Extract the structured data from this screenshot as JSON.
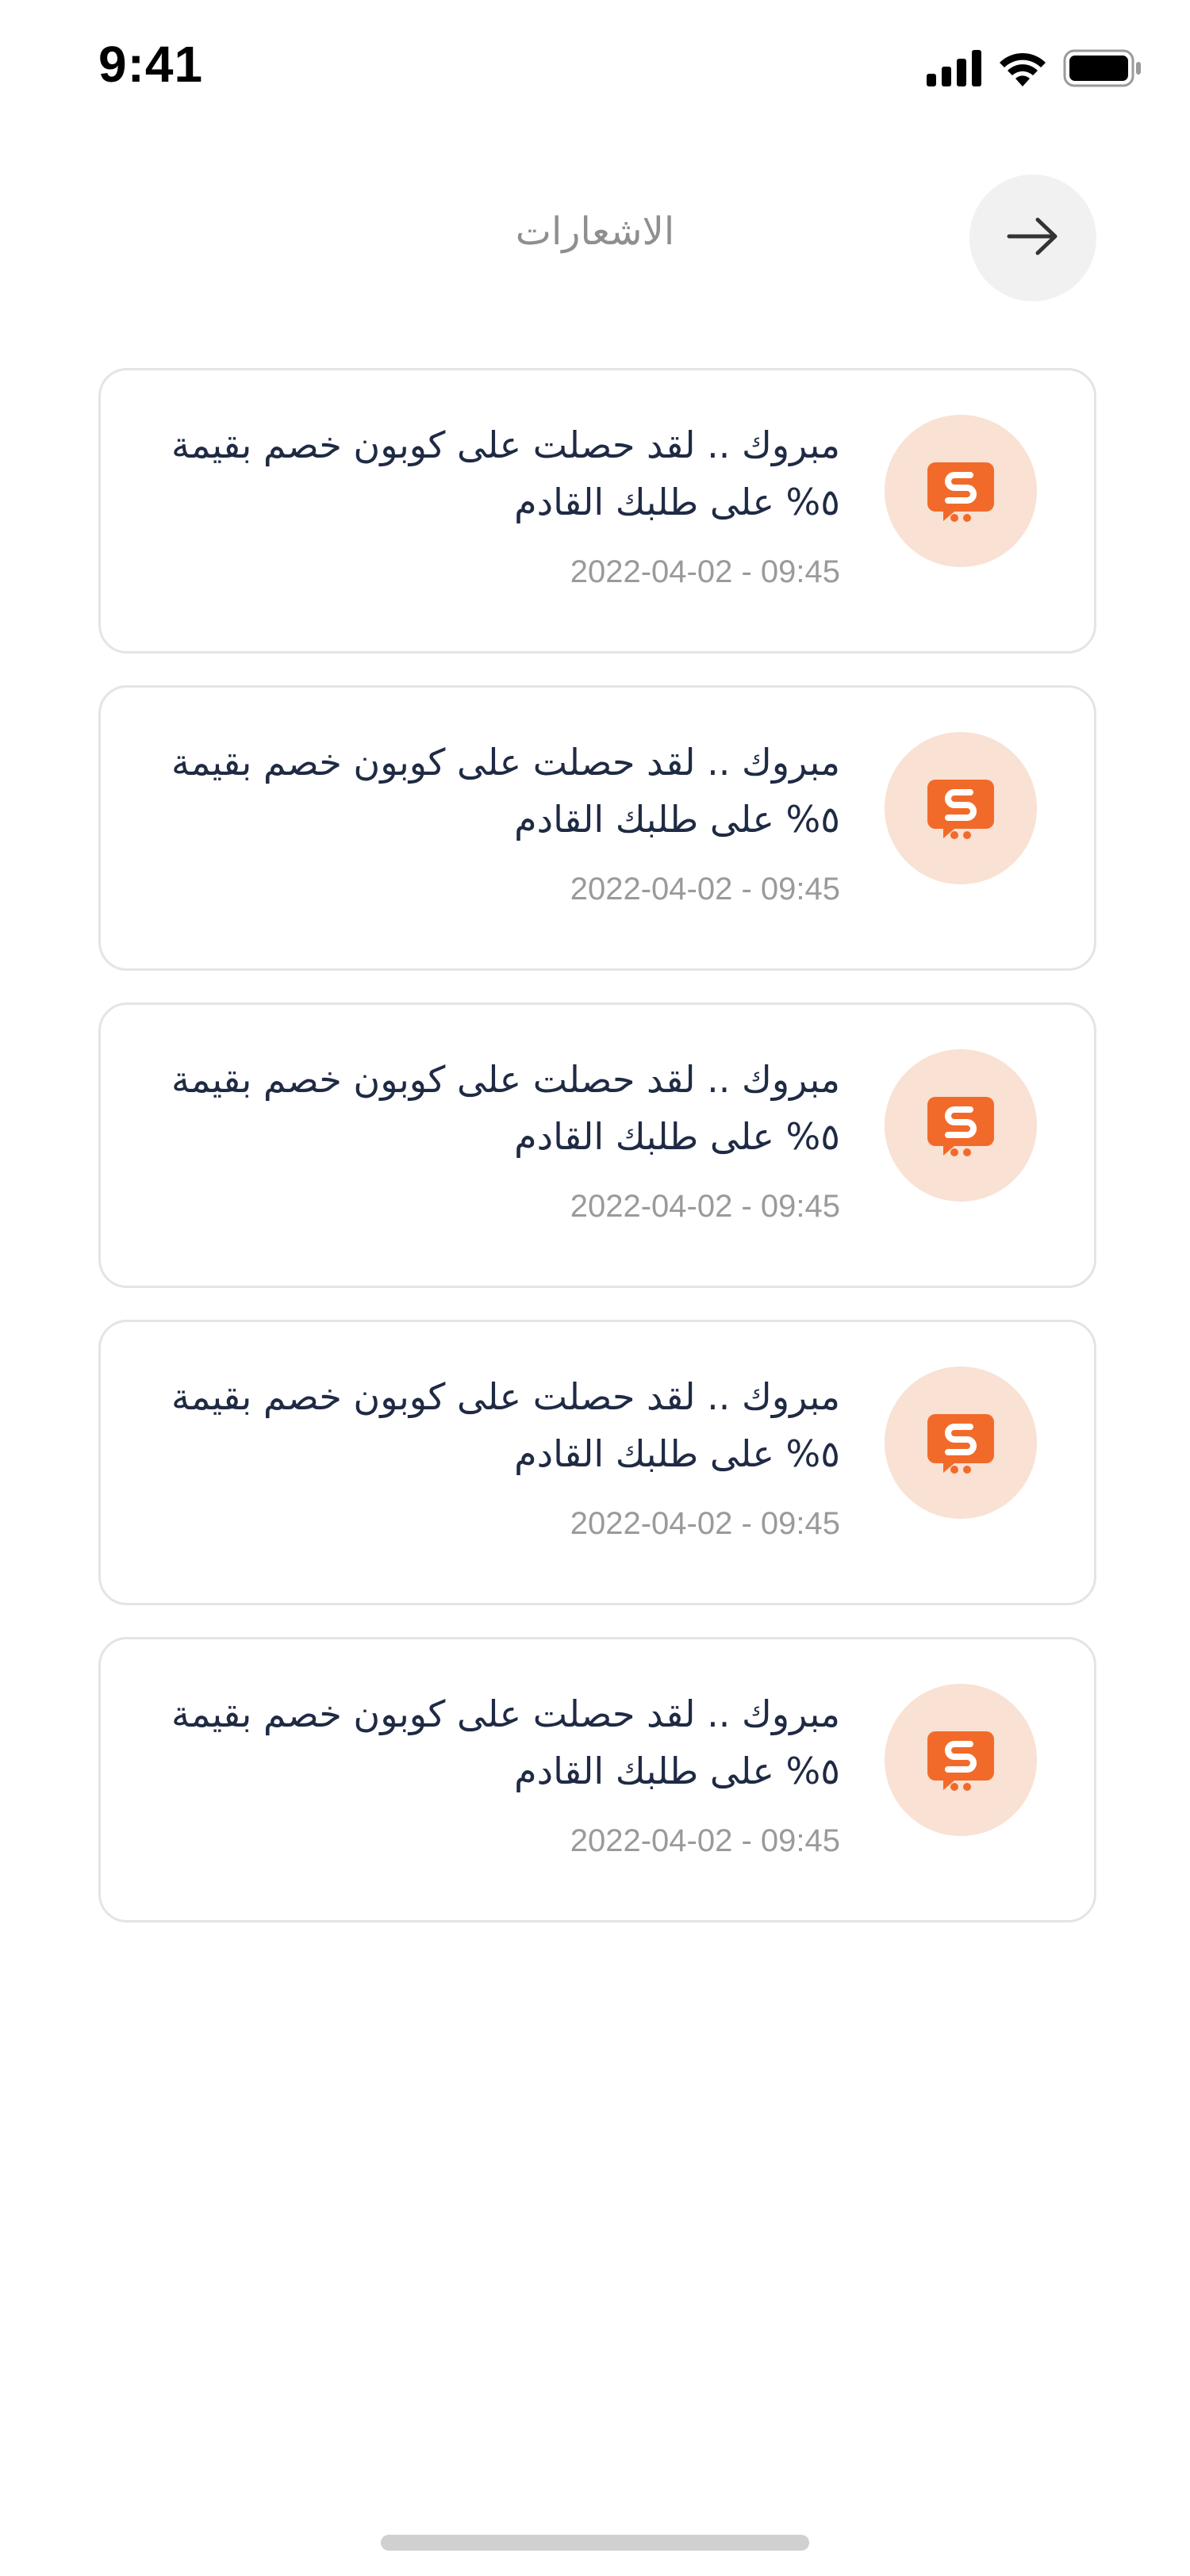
{
  "status_bar": {
    "time": "9:41",
    "icons": [
      "cellular-signal-icon",
      "wifi-icon",
      "battery-icon"
    ]
  },
  "header": {
    "title": "الاشعارات",
    "back_icon": "arrow-right-icon"
  },
  "notifications": [
    {
      "text": "مبروك .. لقد حصلت على كوبون خصم بقيمة ٥% على طلبك القادم",
      "timestamp": "2022-04-02 - 09:45",
      "icon": "app-logo-icon"
    },
    {
      "text": "مبروك .. لقد حصلت على كوبون خصم بقيمة ٥% على طلبك القادم",
      "timestamp": "2022-04-02 - 09:45",
      "icon": "app-logo-icon"
    },
    {
      "text": "مبروك .. لقد حصلت على كوبون خصم بقيمة ٥% على طلبك القادم",
      "timestamp": "2022-04-02 - 09:45",
      "icon": "app-logo-icon"
    },
    {
      "text": "مبروك .. لقد حصلت على كوبون خصم بقيمة ٥% على طلبك القادم",
      "timestamp": "2022-04-02 - 09:45",
      "icon": "app-logo-icon"
    },
    {
      "text": "مبروك .. لقد حصلت على كوبون خصم بقيمة ٥% على طلبك القادم",
      "timestamp": "2022-04-02 - 09:45",
      "icon": "app-logo-icon"
    }
  ],
  "colors": {
    "accent": "#f26a2a",
    "avatar_bg": "#f9e1d3",
    "text_primary": "#1f2a44",
    "text_secondary": "#9a9a9a",
    "card_border": "#e4e4e4"
  }
}
